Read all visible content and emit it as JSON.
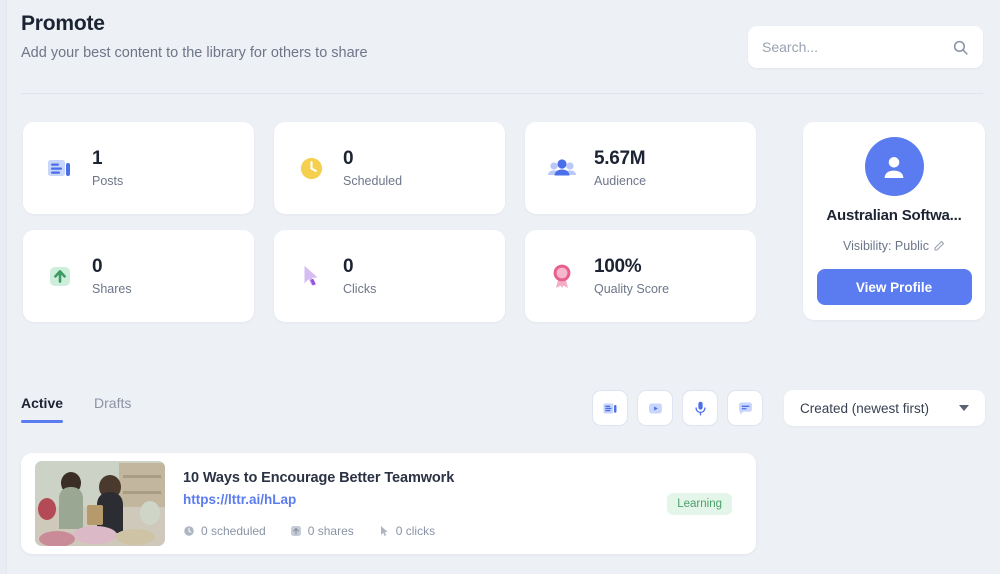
{
  "header": {
    "title": "Promote",
    "subtitle": "Add your best content to the library for others to share"
  },
  "search": {
    "placeholder": "Search...",
    "value": "",
    "icon": "search-icon"
  },
  "stats": [
    {
      "value": "1",
      "label": "Posts",
      "icon": "article-icon",
      "color": "#5b7cf0"
    },
    {
      "value": "0",
      "label": "Scheduled",
      "icon": "clock-icon",
      "color": "#f4d04e"
    },
    {
      "value": "5.67M",
      "label": "Audience",
      "icon": "people-icon",
      "color": "#5b7cf0"
    },
    {
      "value": "0",
      "label": "Shares",
      "icon": "share-up-icon",
      "color": "#4aa06a"
    },
    {
      "value": "0",
      "label": "Clicks",
      "icon": "cursor-icon",
      "color": "#a06ae0"
    },
    {
      "value": "100%",
      "label": "Quality Score",
      "icon": "rosette-icon",
      "color": "#e8608c"
    }
  ],
  "profile": {
    "avatar_icon": "user-avatar-icon",
    "name": "Australian Softwa...",
    "visibility": "Visibility: Public",
    "edit_icon": "pencil-icon",
    "button_label": "View Profile",
    "accent": "#5b7cf0"
  },
  "tabs": [
    {
      "label": "Active",
      "active": true
    },
    {
      "label": "Drafts",
      "active": false
    }
  ],
  "filters": [
    {
      "name": "article-filter",
      "icon": "article-icon"
    },
    {
      "name": "video-filter",
      "icon": "play-icon"
    },
    {
      "name": "audio-filter",
      "icon": "microphone-icon"
    },
    {
      "name": "text-filter",
      "icon": "chat-icon"
    }
  ],
  "sort": {
    "selected": "Created (newest first)",
    "options": [
      "Created (newest first)"
    ]
  },
  "posts": [
    {
      "title": "10 Ways to Encourage Better Teamwork",
      "url": "https://lttr.ai/hLap",
      "thumbnail_alt": "two women arranging flowers in a florist shop",
      "metrics": [
        {
          "icon": "clock-icon",
          "text": "0 scheduled"
        },
        {
          "icon": "share-up-icon",
          "text": "0 shares"
        },
        {
          "icon": "cursor-icon",
          "text": "0 clicks"
        }
      ],
      "badge": "Learning",
      "badge_color": "#4aa06a"
    }
  ]
}
